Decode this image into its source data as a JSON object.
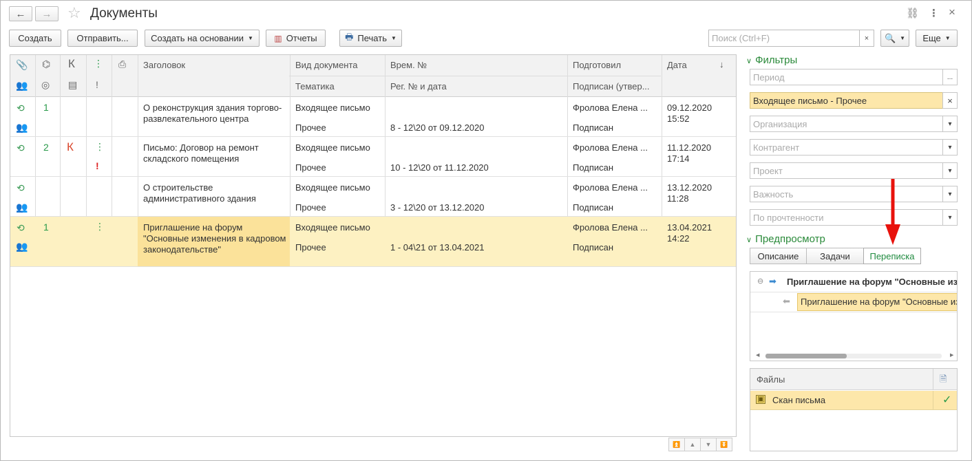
{
  "window": {
    "title": "Документы",
    "back_icon": "←",
    "forward_icon": "→",
    "star_icon": "☆",
    "link_icon": "⛓",
    "more_icon": "⋮",
    "close_icon": "×"
  },
  "toolbar": {
    "create": "Создать",
    "send": "Отправить...",
    "create_based": "Создать на основании",
    "reports": "Отчеты",
    "print": "Печать",
    "search_placeholder": "Поиск (Ctrl+F)",
    "search_clear": "×",
    "more": "Еще"
  },
  "table": {
    "headers": {
      "title": "Заголовок",
      "doc_type": "Вид документа",
      "doc_subject": "Тематика",
      "temp_no": "Врем. №",
      "reg_no": "Рег. № и дата",
      "prepared": "Подготовил",
      "signed": "Подписан (утвер...",
      "date": "Дата",
      "sort_arrow": "↓",
      "k": "К",
      "excl": "!"
    },
    "rows": [
      {
        "num": "1",
        "k": "",
        "task": false,
        "excl": "",
        "title": "О реконструкция здания торгово-развлекательного центра",
        "doc_type": "Входящее письмо",
        "subject": "Прочее",
        "temp_no": "",
        "reg_no": "8 - 12\\20 от 09.12.2020",
        "prepared": "Фролова Елена ...",
        "signed": "Подписан",
        "date": "09.12.2020",
        "time": "15:52",
        "selected": false
      },
      {
        "num": "2",
        "k": "К",
        "task": true,
        "excl": "!",
        "title": "Письмо: Договор на ремонт складского помещения",
        "doc_type": "Входящее письмо",
        "subject": "Прочее",
        "temp_no": "",
        "reg_no": "10 - 12\\20 от 11.12.2020",
        "prepared": "Фролова Елена ...",
        "signed": "Подписан",
        "date": "11.12.2020",
        "time": "17:14",
        "selected": false
      },
      {
        "num": "",
        "k": "",
        "task": false,
        "excl": "",
        "title": "О строительстве административного здания",
        "doc_type": "Входящее письмо",
        "subject": "Прочее",
        "temp_no": "",
        "reg_no": "3 - 12\\20 от 13.12.2020",
        "prepared": "Фролова Елена ...",
        "signed": "Подписан",
        "date": "13.12.2020",
        "time": "11:28",
        "selected": false
      },
      {
        "num": "1",
        "k": "",
        "task": true,
        "excl": "",
        "title": "Приглашение на форум \"Основные изменения в кадровом законодательстве\"",
        "doc_type": "Входящее письмо",
        "subject": "Прочее",
        "temp_no": "",
        "reg_no": "1 - 04\\21 от 13.04.2021",
        "prepared": "Фролова Елена ...",
        "signed": "Подписан",
        "date": "13.04.2021",
        "time": "14:22",
        "selected": true
      }
    ]
  },
  "filters": {
    "section_title": "Фильтры",
    "period_placeholder": "Период",
    "period_btn": "...",
    "doc_type_value": "Входящее письмо - Прочее",
    "clear": "×",
    "org_placeholder": "Организация",
    "counterparty_placeholder": "Контрагент",
    "project_placeholder": "Проект",
    "importance_placeholder": "Важность",
    "read_placeholder": "По прочтенности",
    "dropdown": "▾"
  },
  "preview": {
    "section_title": "Предпросмотр",
    "tabs": [
      "Описание",
      "Задачи",
      "Переписка"
    ],
    "active_tab": "Переписка",
    "item_outgoing": "Приглашение на форум \"Основные из",
    "item_incoming": "Приглашение на форум \"Основные из",
    "collapse": "⊖"
  },
  "files": {
    "header": "Файлы",
    "items": [
      {
        "name": "Скан письма",
        "check": "✓"
      }
    ]
  },
  "colors": {
    "accent_green": "#2a8a3a",
    "selection": "#fdf1c2",
    "selection_strong": "#fbe29a",
    "arrow_red": "#e8120c"
  }
}
